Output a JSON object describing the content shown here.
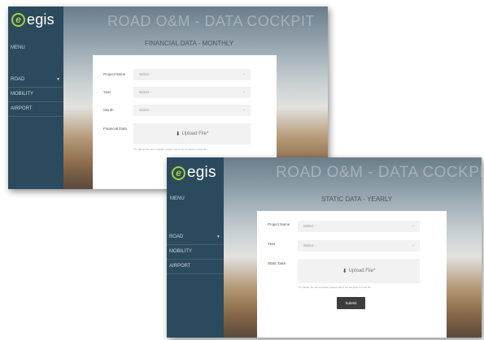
{
  "screens": [
    {
      "logo": {
        "mark": "e",
        "text": "egis"
      },
      "app_title": "ROAD O&M - DATA COCKPIT",
      "menu_label": "MENU",
      "nav": [
        {
          "label": "ROAD",
          "has_chevron": true
        },
        {
          "label": "MOBILITY",
          "has_chevron": false
        },
        {
          "label": "AIRPORT",
          "has_chevron": false
        }
      ],
      "page_heading": "FINANCIAL DATA - MONTHLY",
      "fields": [
        {
          "label": "Project Name",
          "placeholder": "Select -"
        },
        {
          "label": "Year",
          "placeholder": "Select -"
        },
        {
          "label": "Month",
          "placeholder": "Select -"
        }
      ],
      "upload": {
        "label": "Financial Data",
        "button": "Upload File*"
      },
      "note": "*To upload the new template, please select the template to reset file"
    },
    {
      "logo": {
        "mark": "e",
        "text": "egis"
      },
      "app_title": "ROAD O&M - DATA COCKPIT",
      "menu_label": "MENU",
      "nav": [
        {
          "label": "ROAD",
          "has_chevron": true
        },
        {
          "label": "MOBILITY",
          "has_chevron": false
        },
        {
          "label": "AIRPORT",
          "has_chevron": false
        }
      ],
      "page_heading": "STATIC DATA - YEARLY",
      "fields": [
        {
          "label": "Project Name",
          "placeholder": "Select -"
        },
        {
          "label": "Year",
          "placeholder": "Select -"
        }
      ],
      "upload": {
        "label": "Static Data",
        "button": "Upload File*"
      },
      "note": "*To upload the new template, please select the template to reset file",
      "submit": "Submit"
    }
  ],
  "colors": {
    "sidebar": "#2c4a5d",
    "logo_green": "#a6ce39",
    "submit": "#3d3d3d"
  },
  "icons": {
    "upload": "upload-icon",
    "caret": "chevron-down-icon"
  }
}
